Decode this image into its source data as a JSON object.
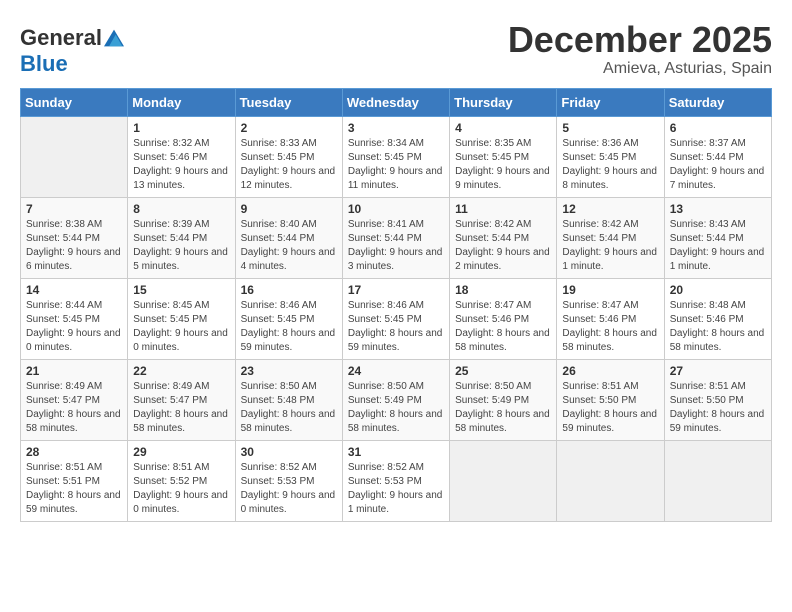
{
  "header": {
    "logo_general": "General",
    "logo_blue": "Blue",
    "month_title": "December 2025",
    "location": "Amieva, Asturias, Spain"
  },
  "days_of_week": [
    "Sunday",
    "Monday",
    "Tuesday",
    "Wednesday",
    "Thursday",
    "Friday",
    "Saturday"
  ],
  "weeks": [
    [
      {
        "day": "",
        "sunrise": "",
        "sunset": "",
        "daylight": ""
      },
      {
        "day": "1",
        "sunrise": "Sunrise: 8:32 AM",
        "sunset": "Sunset: 5:46 PM",
        "daylight": "Daylight: 9 hours and 13 minutes."
      },
      {
        "day": "2",
        "sunrise": "Sunrise: 8:33 AM",
        "sunset": "Sunset: 5:45 PM",
        "daylight": "Daylight: 9 hours and 12 minutes."
      },
      {
        "day": "3",
        "sunrise": "Sunrise: 8:34 AM",
        "sunset": "Sunset: 5:45 PM",
        "daylight": "Daylight: 9 hours and 11 minutes."
      },
      {
        "day": "4",
        "sunrise": "Sunrise: 8:35 AM",
        "sunset": "Sunset: 5:45 PM",
        "daylight": "Daylight: 9 hours and 9 minutes."
      },
      {
        "day": "5",
        "sunrise": "Sunrise: 8:36 AM",
        "sunset": "Sunset: 5:45 PM",
        "daylight": "Daylight: 9 hours and 8 minutes."
      },
      {
        "day": "6",
        "sunrise": "Sunrise: 8:37 AM",
        "sunset": "Sunset: 5:44 PM",
        "daylight": "Daylight: 9 hours and 7 minutes."
      }
    ],
    [
      {
        "day": "7",
        "sunrise": "Sunrise: 8:38 AM",
        "sunset": "Sunset: 5:44 PM",
        "daylight": "Daylight: 9 hours and 6 minutes."
      },
      {
        "day": "8",
        "sunrise": "Sunrise: 8:39 AM",
        "sunset": "Sunset: 5:44 PM",
        "daylight": "Daylight: 9 hours and 5 minutes."
      },
      {
        "day": "9",
        "sunrise": "Sunrise: 8:40 AM",
        "sunset": "Sunset: 5:44 PM",
        "daylight": "Daylight: 9 hours and 4 minutes."
      },
      {
        "day": "10",
        "sunrise": "Sunrise: 8:41 AM",
        "sunset": "Sunset: 5:44 PM",
        "daylight": "Daylight: 9 hours and 3 minutes."
      },
      {
        "day": "11",
        "sunrise": "Sunrise: 8:42 AM",
        "sunset": "Sunset: 5:44 PM",
        "daylight": "Daylight: 9 hours and 2 minutes."
      },
      {
        "day": "12",
        "sunrise": "Sunrise: 8:42 AM",
        "sunset": "Sunset: 5:44 PM",
        "daylight": "Daylight: 9 hours and 1 minute."
      },
      {
        "day": "13",
        "sunrise": "Sunrise: 8:43 AM",
        "sunset": "Sunset: 5:44 PM",
        "daylight": "Daylight: 9 hours and 1 minute."
      }
    ],
    [
      {
        "day": "14",
        "sunrise": "Sunrise: 8:44 AM",
        "sunset": "Sunset: 5:45 PM",
        "daylight": "Daylight: 9 hours and 0 minutes."
      },
      {
        "day": "15",
        "sunrise": "Sunrise: 8:45 AM",
        "sunset": "Sunset: 5:45 PM",
        "daylight": "Daylight: 9 hours and 0 minutes."
      },
      {
        "day": "16",
        "sunrise": "Sunrise: 8:46 AM",
        "sunset": "Sunset: 5:45 PM",
        "daylight": "Daylight: 8 hours and 59 minutes."
      },
      {
        "day": "17",
        "sunrise": "Sunrise: 8:46 AM",
        "sunset": "Sunset: 5:45 PM",
        "daylight": "Daylight: 8 hours and 59 minutes."
      },
      {
        "day": "18",
        "sunrise": "Sunrise: 8:47 AM",
        "sunset": "Sunset: 5:46 PM",
        "daylight": "Daylight: 8 hours and 58 minutes."
      },
      {
        "day": "19",
        "sunrise": "Sunrise: 8:47 AM",
        "sunset": "Sunset: 5:46 PM",
        "daylight": "Daylight: 8 hours and 58 minutes."
      },
      {
        "day": "20",
        "sunrise": "Sunrise: 8:48 AM",
        "sunset": "Sunset: 5:46 PM",
        "daylight": "Daylight: 8 hours and 58 minutes."
      }
    ],
    [
      {
        "day": "21",
        "sunrise": "Sunrise: 8:49 AM",
        "sunset": "Sunset: 5:47 PM",
        "daylight": "Daylight: 8 hours and 58 minutes."
      },
      {
        "day": "22",
        "sunrise": "Sunrise: 8:49 AM",
        "sunset": "Sunset: 5:47 PM",
        "daylight": "Daylight: 8 hours and 58 minutes."
      },
      {
        "day": "23",
        "sunrise": "Sunrise: 8:50 AM",
        "sunset": "Sunset: 5:48 PM",
        "daylight": "Daylight: 8 hours and 58 minutes."
      },
      {
        "day": "24",
        "sunrise": "Sunrise: 8:50 AM",
        "sunset": "Sunset: 5:49 PM",
        "daylight": "Daylight: 8 hours and 58 minutes."
      },
      {
        "day": "25",
        "sunrise": "Sunrise: 8:50 AM",
        "sunset": "Sunset: 5:49 PM",
        "daylight": "Daylight: 8 hours and 58 minutes."
      },
      {
        "day": "26",
        "sunrise": "Sunrise: 8:51 AM",
        "sunset": "Sunset: 5:50 PM",
        "daylight": "Daylight: 8 hours and 59 minutes."
      },
      {
        "day": "27",
        "sunrise": "Sunrise: 8:51 AM",
        "sunset": "Sunset: 5:50 PM",
        "daylight": "Daylight: 8 hours and 59 minutes."
      }
    ],
    [
      {
        "day": "28",
        "sunrise": "Sunrise: 8:51 AM",
        "sunset": "Sunset: 5:51 PM",
        "daylight": "Daylight: 8 hours and 59 minutes."
      },
      {
        "day": "29",
        "sunrise": "Sunrise: 8:51 AM",
        "sunset": "Sunset: 5:52 PM",
        "daylight": "Daylight: 9 hours and 0 minutes."
      },
      {
        "day": "30",
        "sunrise": "Sunrise: 8:52 AM",
        "sunset": "Sunset: 5:53 PM",
        "daylight": "Daylight: 9 hours and 0 minutes."
      },
      {
        "day": "31",
        "sunrise": "Sunrise: 8:52 AM",
        "sunset": "Sunset: 5:53 PM",
        "daylight": "Daylight: 9 hours and 1 minute."
      },
      {
        "day": "",
        "sunrise": "",
        "sunset": "",
        "daylight": ""
      },
      {
        "day": "",
        "sunrise": "",
        "sunset": "",
        "daylight": ""
      },
      {
        "day": "",
        "sunrise": "",
        "sunset": "",
        "daylight": ""
      }
    ]
  ]
}
